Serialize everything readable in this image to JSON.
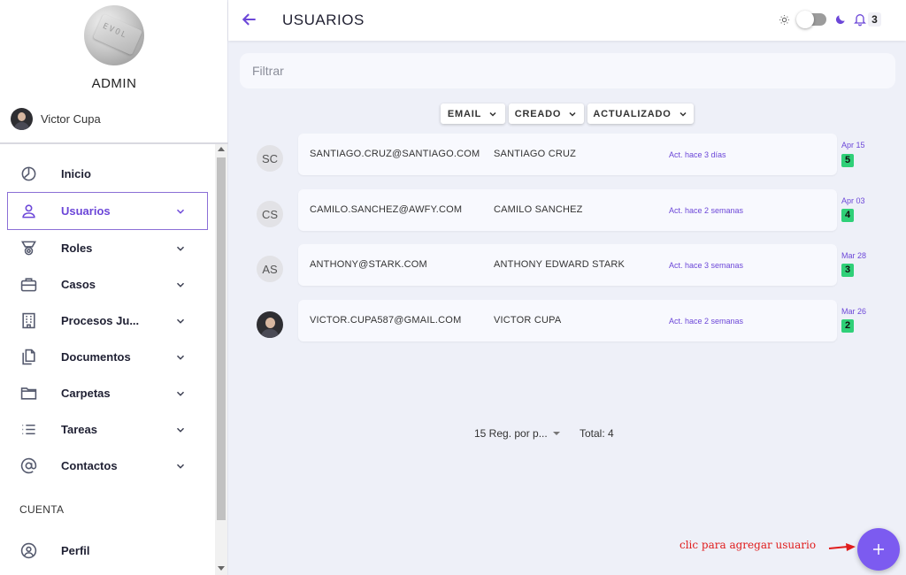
{
  "sidebar": {
    "logo_text": "EVOL",
    "title": "ADMIN",
    "user_name": "Victor Cupa",
    "items": [
      {
        "label": "Inicio",
        "icon": "clock-icon"
      },
      {
        "label": "Usuarios",
        "icon": "user-icon"
      },
      {
        "label": "Roles",
        "icon": "medal-icon"
      },
      {
        "label": "Casos",
        "icon": "briefcase-icon"
      },
      {
        "label": "Procesos Ju...",
        "icon": "building-icon"
      },
      {
        "label": "Documentos",
        "icon": "documents-icon"
      },
      {
        "label": "Carpetas",
        "icon": "folder-icon"
      },
      {
        "label": "Tareas",
        "icon": "list-icon"
      },
      {
        "label": "Contactos",
        "icon": "at-icon"
      }
    ],
    "section_label": "CUENTA",
    "profile_label": "Perfil"
  },
  "header": {
    "title": "USUARIOS",
    "notification_count": "3"
  },
  "filter": {
    "placeholder": "Filtrar"
  },
  "sort_buttons": [
    "EMAIL",
    "CREADO",
    "ACTUALIZADO"
  ],
  "users": [
    {
      "initials": "SC",
      "email": "SANTIAGO.CRUZ@SANTIAGO.COM",
      "name": "SANTIAGO CRUZ",
      "updated": "Act. hace 3 días",
      "date": "Apr 15",
      "count": "5"
    },
    {
      "initials": "CS",
      "email": "CAMILO.SANCHEZ@AWFY.COM",
      "name": "CAMILO SANCHEZ",
      "updated": "Act. hace 2 semanas",
      "date": "Apr 03",
      "count": "4"
    },
    {
      "initials": "AS",
      "email": "ANTHONY@STARK.COM",
      "name": "ANTHONY EDWARD STARK",
      "updated": "Act. hace 3 semanas",
      "date": "Mar 28",
      "count": "3"
    },
    {
      "initials": "",
      "email": "VICTOR.CUPA587@GMAIL.COM",
      "name": "VICTOR CUPA",
      "updated": "Act. hace 2 semanas",
      "date": "Mar 26",
      "count": "2"
    }
  ],
  "pagination": {
    "per_page": "15 Reg. por p...",
    "total": "Total: 4"
  },
  "annotation": "clic para agregar usuario",
  "colors": {
    "accent": "#6c47d8",
    "fab": "#7c5bf0",
    "count_badge": "#2fd078",
    "annotation": "#e01c1c"
  }
}
